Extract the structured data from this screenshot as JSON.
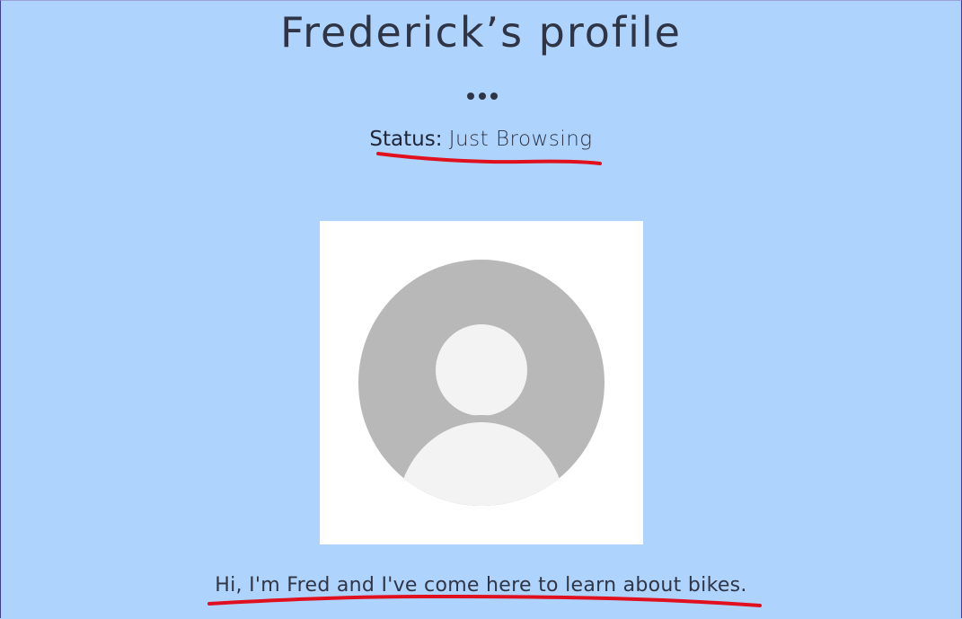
{
  "profile": {
    "title": "Frederick’s profile",
    "more_icon": "more-horizontal-icon",
    "status_label": "Status:",
    "status_value": "Just Browsing",
    "avatar_icon": "default-user-avatar-icon",
    "bio": "Hi, I'm Fred and I've come here to learn about bikes."
  },
  "colors": {
    "background": "#aed3fd",
    "text": "#2f3545",
    "annotation": "#e0101e",
    "avatar_circle": "#b8b8b8",
    "avatar_person": "#f3f3f3"
  }
}
